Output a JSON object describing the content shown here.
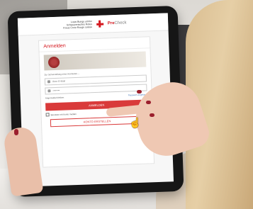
{
  "header": {
    "org_text": "Louis Bungy ummo Schweizerisches Rotes Kreuz Croix-Rouge suisse",
    "brand_main": "Pre",
    "brand_sub": "Check"
  },
  "login": {
    "title": "Anmelden",
    "banner_text": "",
    "info_text": "Zur Sicherstellung eines Kontextes ...",
    "info_link": "",
    "username_value": "Ihrer E-Mail",
    "password_value": "••••••••",
    "remember_label": "Angemeldet bleiben",
    "forgot_link": "Passwort vergessen",
    "login_button": "ANMELDEN",
    "checkbox_label": "Benutzer mit Konto melden",
    "register_button": "KONTO ERSTELLEN",
    "extra_link": "",
    "footer_text": ""
  },
  "colors": {
    "accent": "#d4181f",
    "button": "#d93a3a",
    "link": "#3b6fb5"
  }
}
